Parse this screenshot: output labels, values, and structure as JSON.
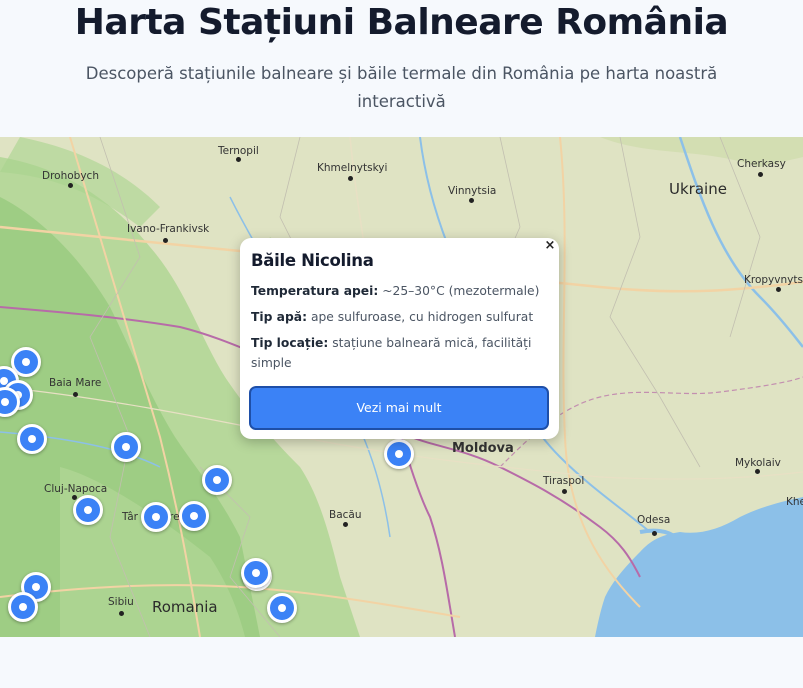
{
  "header": {
    "title": "Harta Stațiuni Balneare România",
    "subtitle": "Descoperă stațiunile balneare și băile termale din România pe harta noastră interactivă"
  },
  "map": {
    "cities": [
      "Ternopil",
      "Khmelnytskyi",
      "Drohobych",
      "Vinnytsia",
      "Cherkasy",
      "Ivano-Frankivsk",
      "Kropyvnytsk",
      "Baia Mare",
      "Cluj-Napoca",
      "Târ",
      "rea",
      "Bacău",
      "Tiraspol",
      "Mykolaiv",
      "Odesa",
      "Sibiu",
      "Khe"
    ],
    "countries": [
      "Ukraine",
      "Moldova",
      "Romania"
    ],
    "marker_icon": "map-pin-icon",
    "popup": {
      "title": "Băile Nicolina",
      "close_label": "×",
      "rows": [
        {
          "label": "Temperatura apei:",
          "value": "~25–30°C (mezotermale)"
        },
        {
          "label": "Tip apă:",
          "value": "ape sulfuroase, cu hidrogen sulfurat"
        },
        {
          "label": "Tip locație:",
          "value": "stațiune balneară mică, facilități simple"
        }
      ],
      "button": "Vezi mai mult"
    },
    "colors": {
      "marker": "#3b82f6",
      "water": "#8cc0e8",
      "land": "#dfe3c3",
      "forest": "#9ecf83"
    }
  }
}
